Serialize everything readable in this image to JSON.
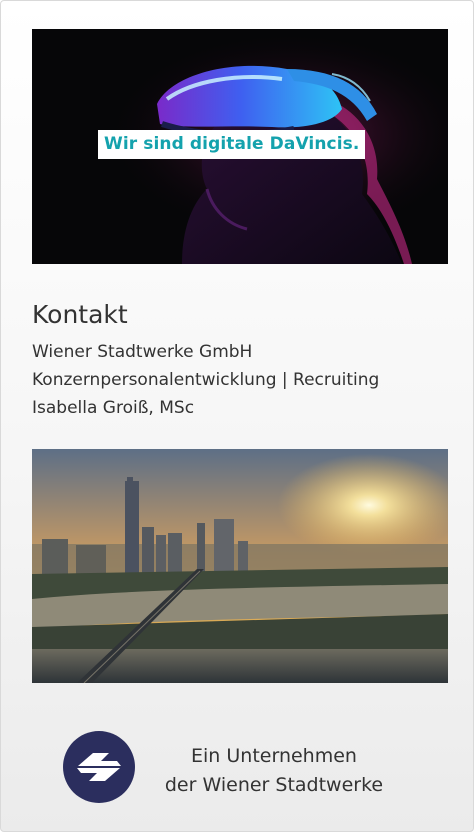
{
  "hero": {
    "banner_text": "Wir sind digitale DaVincis.",
    "banner_color": "#14a2ad"
  },
  "contact": {
    "title": "Kontakt",
    "company": "Wiener Stadtwerke GmbH",
    "department": "Konzernpersonalentwicklung | Recruiting",
    "person": "Isabella Groiß, MSc"
  },
  "footer": {
    "logo_icon": "wiener-stadtwerke-logo-icon",
    "logo_color": "#2b2e5e",
    "tagline_line1": "Ein Unternehmen",
    "tagline_line2": "der Wiener Stadtwerke"
  }
}
